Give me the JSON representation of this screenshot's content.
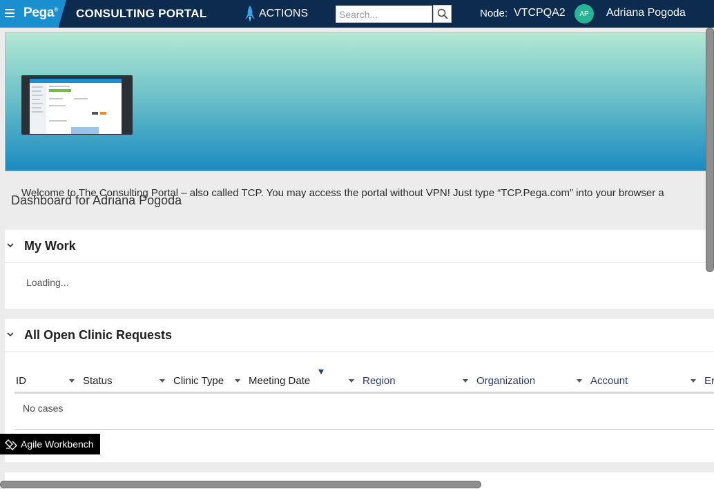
{
  "header": {
    "brand": "Pega",
    "brand_mark": "®",
    "app_title": "CONSULTING PORTAL",
    "actions_label": "ACTIONS",
    "search_placeholder": "Search...",
    "node_label": "Node:",
    "node_value": "VTCPQA2",
    "avatar_initials": "AP",
    "user_name": "Adriana Pogoda",
    "colors": {
      "bar": "#0d2b4e",
      "brand": "#1a8fd0",
      "avatar": "#23b594"
    }
  },
  "banner": {
    "welcome_text": "Welcome to The Consulting Portal – also called TCP. You may access the portal without VPN! Just type “TCP.Pega.com” into your browser a",
    "image_icon": "laptop-screenshot-illustration"
  },
  "dashboard_title": "Dashboard for Adriana Pogoda",
  "my_work": {
    "title": "My Work",
    "loading_text": "Loading..."
  },
  "clinic_requests": {
    "title": "All Open Clinic Requests",
    "columns": [
      "ID",
      "Status",
      "Clinic Type",
      "Meeting Date",
      "Region",
      "Organization",
      "Account",
      "Er"
    ],
    "empty_text": "No cases"
  },
  "workbench": {
    "label": "Agile Workbench",
    "icon": "eraser-icon"
  }
}
